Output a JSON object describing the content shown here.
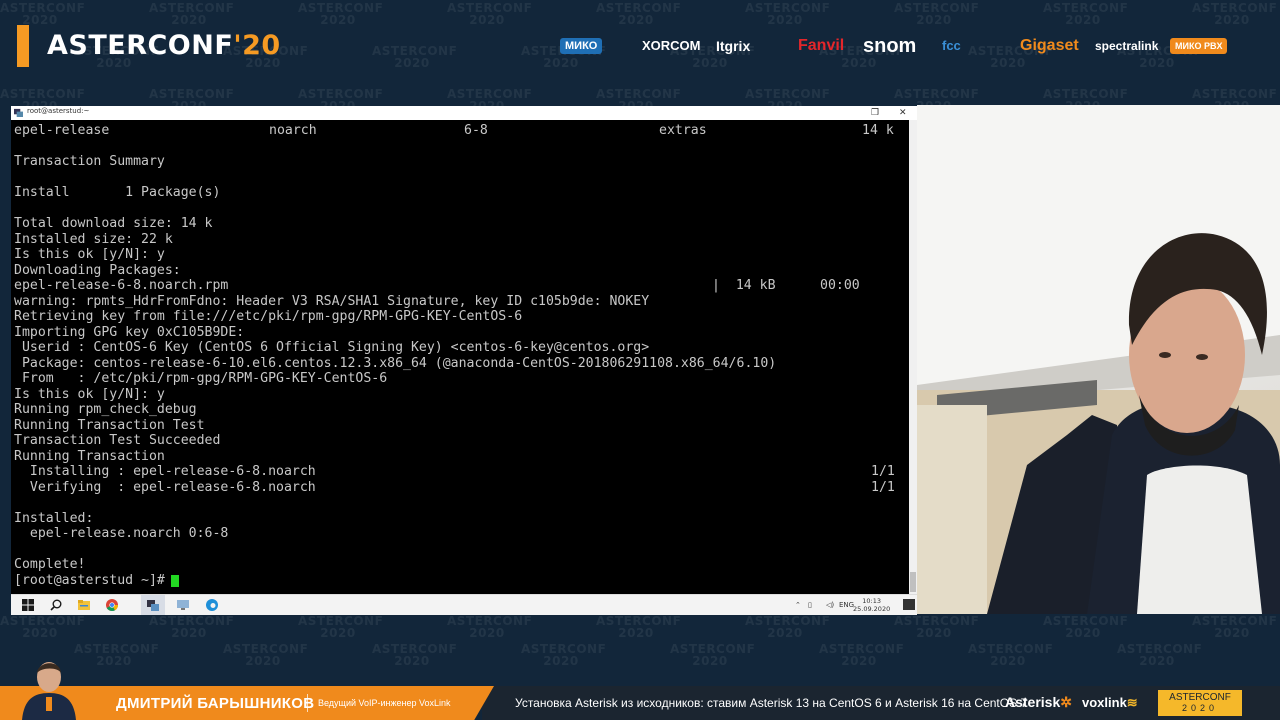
{
  "watermark": "ASTERCONF\n2020",
  "header": {
    "brand_main": "ASTERCONF",
    "brand_year": "'20",
    "sponsors": [
      {
        "name": "МИКО",
        "color": "#ffffff",
        "bg": "#1f6fb5"
      },
      {
        "name": "XORCOM",
        "color": "#ffffff"
      },
      {
        "name": "Itgrix",
        "color": "#ffffff"
      },
      {
        "name": "Fanvil",
        "color": "#e3262b"
      },
      {
        "name": "snom",
        "color": "#ffffff"
      },
      {
        "name": "fcc",
        "color": "#3a8fd6"
      },
      {
        "name": "Gigaset",
        "color": "#f08a1c"
      },
      {
        "name": "spectralink",
        "color": "#ffffff"
      },
      {
        "name": "МИКО PBX",
        "color": "#ffffff",
        "bg": "#f08a1c"
      }
    ]
  },
  "terminal": {
    "title": "root@asterstud:~",
    "lines": [
      {
        "cols": [
          "epel-release",
          "noarch",
          "6-8",
          "extras",
          "14 k"
        ]
      },
      {
        "text": ""
      },
      {
        "text": "Transaction Summary"
      },
      {
        "text": ""
      },
      {
        "text": "Install       1 Package(s)"
      },
      {
        "text": ""
      },
      {
        "text": "Total download size: 14 k"
      },
      {
        "text": "Installed size: 22 k"
      },
      {
        "text": "Is this ok [y/N]: y"
      },
      {
        "text": "Downloading Packages:"
      },
      {
        "cols": [
          "epel-release-6-8.noarch.rpm",
          "|  14 kB",
          "00:00"
        ]
      },
      {
        "text": "warning: rpmts_HdrFromFdno: Header V3 RSA/SHA1 Signature, key ID c105b9de: NOKEY"
      },
      {
        "text": "Retrieving key from file:///etc/pki/rpm-gpg/RPM-GPG-KEY-CentOS-6"
      },
      {
        "text": "Importing GPG key 0xC105B9DE:"
      },
      {
        "text": " Userid : CentOS-6 Key (CentOS 6 Official Signing Key) <centos-6-key@centos.org>"
      },
      {
        "text": " Package: centos-release-6-10.el6.centos.12.3.x86_64 (@anaconda-CentOS-201806291108.x86_64/6.10)"
      },
      {
        "text": " From   : /etc/pki/rpm-gpg/RPM-GPG-KEY-CentOS-6"
      },
      {
        "text": "Is this ok [y/N]: y"
      },
      {
        "text": "Running rpm_check_debug"
      },
      {
        "text": "Running Transaction Test"
      },
      {
        "text": "Transaction Test Succeeded"
      },
      {
        "text": "Running Transaction"
      },
      {
        "cols": [
          "  Installing : epel-release-6-8.noarch",
          "1/1"
        ]
      },
      {
        "cols": [
          "  Verifying  : epel-release-6-8.noarch",
          "1/1"
        ]
      },
      {
        "text": ""
      },
      {
        "text": "Installed:"
      },
      {
        "text": "  epel-release.noarch 0:6-8"
      },
      {
        "text": ""
      },
      {
        "text": "Complete!"
      },
      {
        "text": "[root@asterstud ~]#",
        "cursor": true
      }
    ]
  },
  "taskbar": {
    "tray_lang": "ENG",
    "clock_time": "10:13",
    "clock_date": "25.09.2020"
  },
  "lower_third": {
    "speaker_name": "ДМИТРИЙ БАРЫШНИКОВ",
    "speaker_role": "Ведущий VoIP-инженер VoxLink",
    "talk_title": "Установка Asterisk из исходников: ставим Asterisk 13 на CentOS 6 и Asterisk 16 на CentOS 7",
    "logo_asterisk": "Asterisk",
    "logo_voxlink": "voxlink",
    "badge_line1": "ASTERCONF",
    "badge_line2": "2020"
  }
}
